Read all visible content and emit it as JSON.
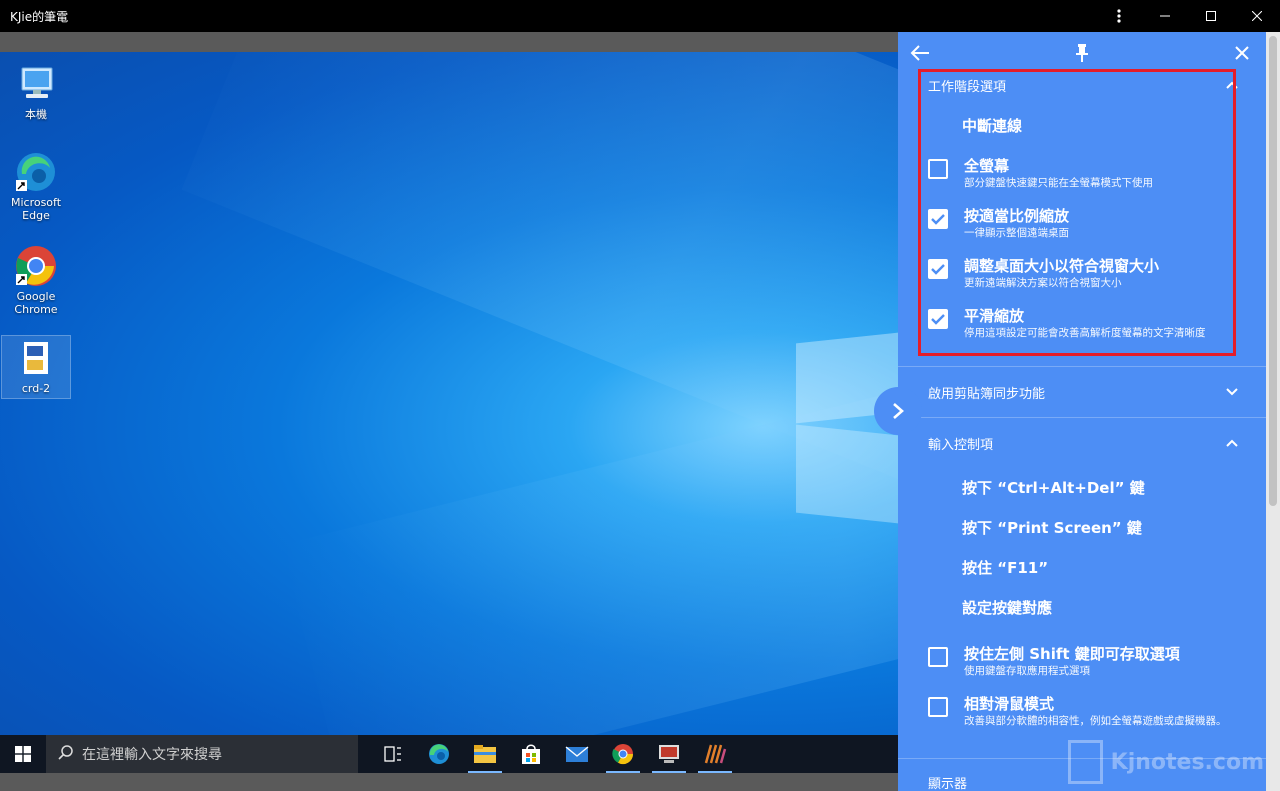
{
  "window": {
    "title": "KJie的筆電",
    "menu_icon": "more-vertical-icon",
    "minimize_icon": "minimize-icon",
    "maximize_icon": "maximize-icon",
    "close_icon": "close-icon"
  },
  "desktop": {
    "icons": [
      {
        "label": "本機",
        "icon": "computer-icon"
      },
      {
        "label": "Microsoft Edge",
        "icon": "edge-icon"
      },
      {
        "label": "Google Chrome",
        "icon": "chrome-icon"
      },
      {
        "label": "crd-2",
        "icon": "file-icon"
      }
    ]
  },
  "taskbar": {
    "search_placeholder": "在這裡輸入文字來搜尋",
    "apps": [
      "task-view-icon",
      "edge-icon",
      "file-explorer-icon",
      "store-icon",
      "mail-icon",
      "chrome-icon",
      "remote-desktop-icon",
      "app-icon"
    ]
  },
  "panel": {
    "back_icon": "arrow-left-icon",
    "pin_icon": "pin-icon",
    "close_icon": "close-icon",
    "session_section": {
      "title": "工作階段選項",
      "disconnect": "中斷連線",
      "options": [
        {
          "label": "全螢幕",
          "desc": "部分鍵盤快速鍵只能在全螢幕模式下使用",
          "checked": false
        },
        {
          "label": "按適當比例縮放",
          "desc": "一律顯示整個遠端桌面",
          "checked": true
        },
        {
          "label": "調整桌面大小以符合視窗大小",
          "desc": "更新遠端解決方案以符合視窗大小",
          "checked": true
        },
        {
          "label": "平滑縮放",
          "desc": "停用這項設定可能會改善高解析度螢幕的文字清晰度",
          "checked": true
        }
      ]
    },
    "clipboard_section": {
      "title": "啟用剪貼簿同步功能"
    },
    "input_section": {
      "title": "輸入控制項",
      "actions": [
        "按下 “Ctrl+Alt+Del” 鍵",
        "按下 “Print Screen” 鍵",
        "按住 “F11”",
        "設定按鍵對應"
      ],
      "options": [
        {
          "label": "按住左側 Shift 鍵即可存取選項",
          "desc": "使用鍵盤存取應用程式選項",
          "checked": false
        },
        {
          "label": "相對滑鼠模式",
          "desc": "改善與部分軟體的相容性，例如全螢幕遊戲或虛擬機器。",
          "checked": false
        }
      ]
    },
    "next_section_title": "顯示器"
  },
  "watermark": {
    "text": "Kjnotes.com"
  },
  "colors": {
    "panel_bg": "#4d8ef5",
    "highlight_border": "#e51d2a",
    "desktop_blue": "#0a78dc"
  }
}
